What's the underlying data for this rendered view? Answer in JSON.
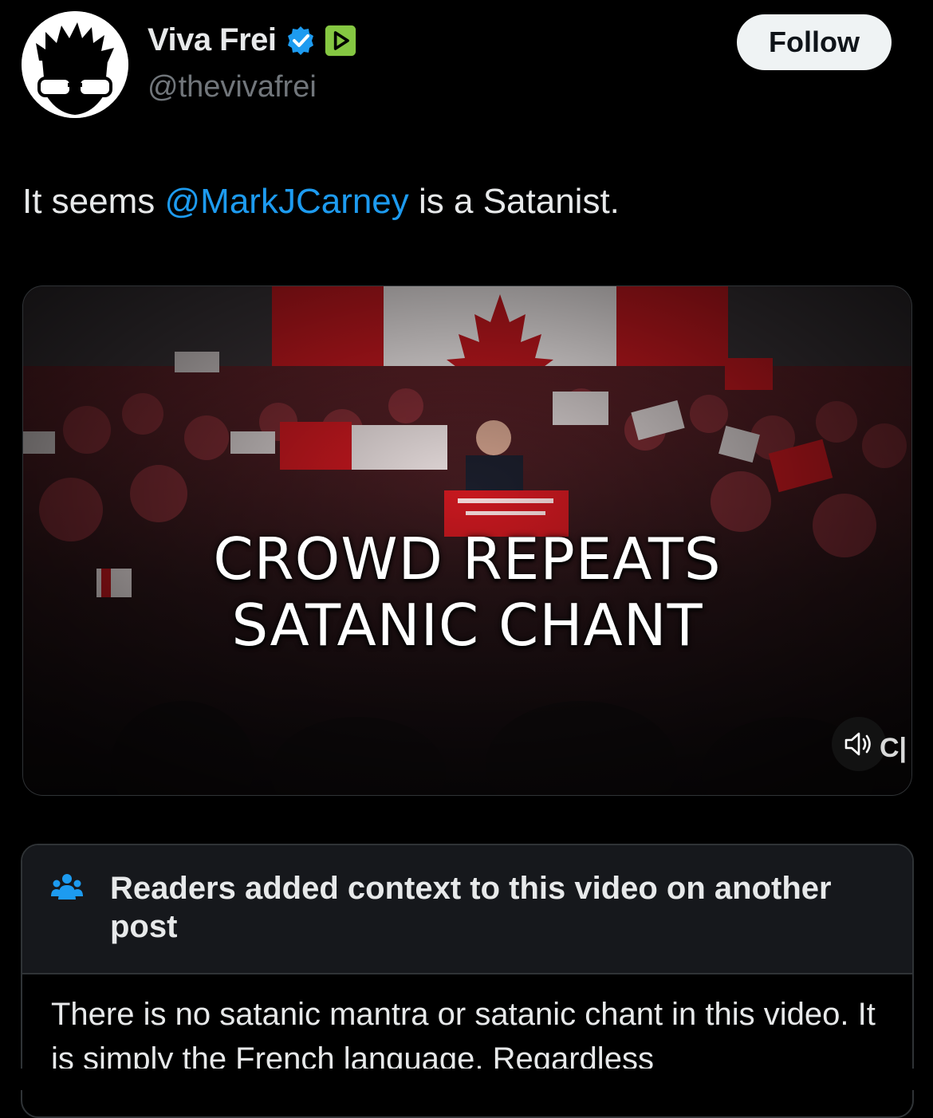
{
  "author": {
    "display_name": "Viva Frei",
    "handle": "@thevivafrei",
    "verified_icon": "verified-badge-icon",
    "platform_icon": "rumble-badge-icon",
    "accent_colors": {
      "verified": "#1d9bf0",
      "rumble": "#85c742"
    }
  },
  "follow_button": {
    "label": "Follow"
  },
  "tweet": {
    "text_before": "It seems ",
    "mention": "@MarkJCarney",
    "text_after": " is a Satanist.",
    "mention_color": "#1d9bf0"
  },
  "media": {
    "overlay_line1": "CROWD REPEATS",
    "overlay_line2": "SATANIC CHANT",
    "sound_icon": "speaker-icon",
    "watermark": "C|"
  },
  "community_note": {
    "icon": "people-group-icon",
    "title": "Readers added context to this video on another post",
    "body": "There is no satanic mantra or satanic chant in this video. It is simply the French language. Regardless"
  }
}
